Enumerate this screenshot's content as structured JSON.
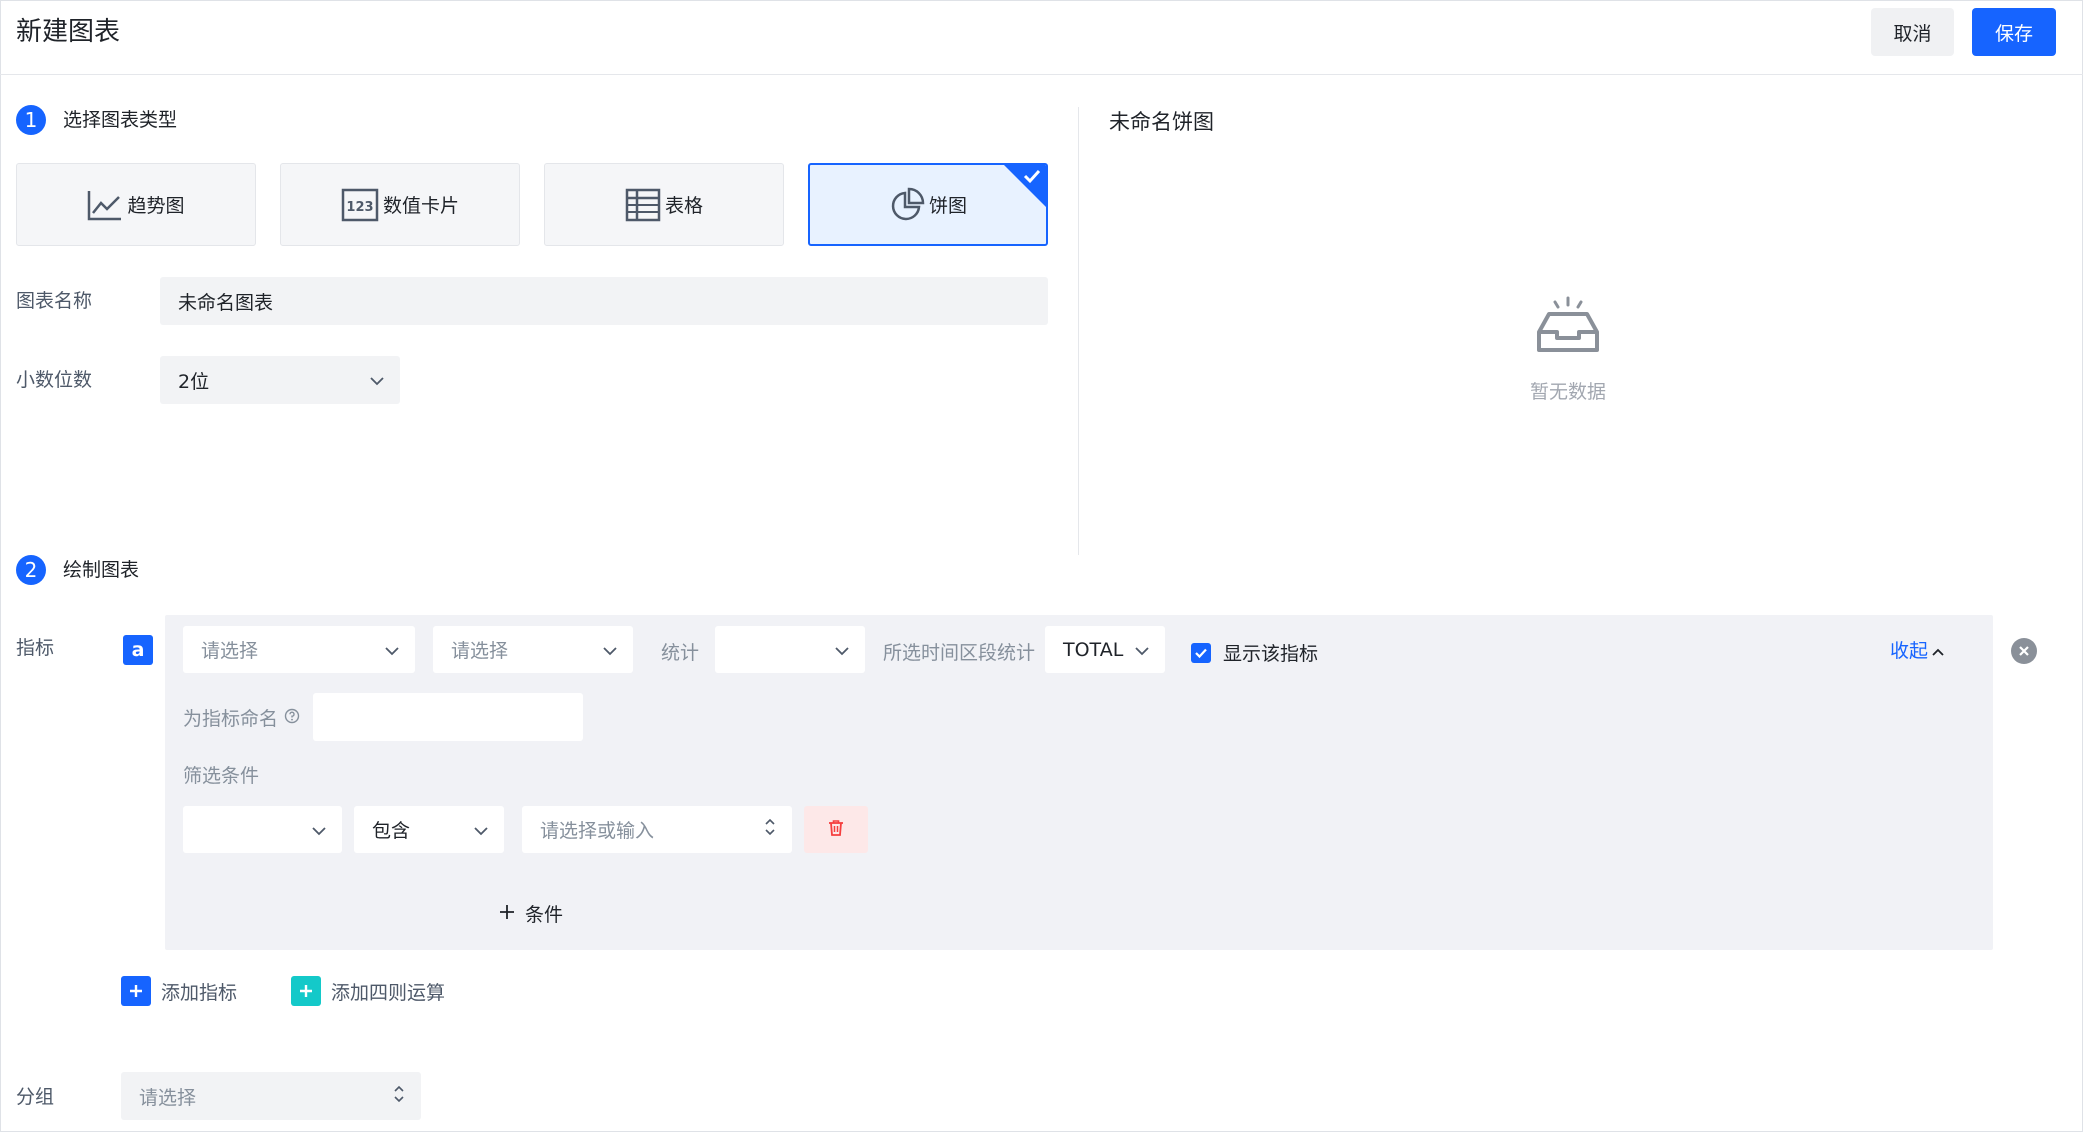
{
  "header": {
    "title": "新建图表",
    "cancel_label": "取消",
    "save_label": "保存"
  },
  "step1": {
    "number": "1",
    "label": "选择图表类型",
    "chart_types": [
      {
        "label": "趋势图",
        "icon": "line-chart-icon",
        "selected": false
      },
      {
        "label": "数值卡片",
        "icon": "number-card-icon",
        "selected": false
      },
      {
        "label": "表格",
        "icon": "table-icon",
        "selected": false
      },
      {
        "label": "饼图",
        "icon": "pie-chart-icon",
        "selected": true
      }
    ]
  },
  "form": {
    "name_label": "图表名称",
    "name_value": "未命名图表",
    "decimal_label": "小数位数",
    "decimal_value": "2位"
  },
  "preview": {
    "title": "未命名饼图",
    "empty_icon": "empty-inbox-icon",
    "empty_text": "暂无数据"
  },
  "step2": {
    "number": "2",
    "label": "绘制图表"
  },
  "metric": {
    "label": "指标",
    "tag": "a",
    "select1_placeholder": "请选择",
    "select2_placeholder": "请选择",
    "stat_label": "统计",
    "stat_value": "",
    "period_label": "所选时间区段统计",
    "period_value": "TOTAL",
    "show_label": "显示该指标",
    "show_checked": true,
    "collapse_label": "收起",
    "rename_label": "为指标命名",
    "rename_value": "",
    "filter_label": "筛选条件",
    "filter_field": "",
    "filter_op": "包含",
    "filter_value_placeholder": "请选择或输入",
    "add_condition_label": "条件"
  },
  "actions": {
    "add_metric_label": "添加指标",
    "add_formula_label": "添加四则运算"
  },
  "group": {
    "label": "分组",
    "placeholder": "请选择"
  },
  "colors": {
    "primary": "#1664ff",
    "teal": "#14c9c9",
    "danger": "#f53f3f",
    "panel_bg": "#f1f2f6"
  }
}
